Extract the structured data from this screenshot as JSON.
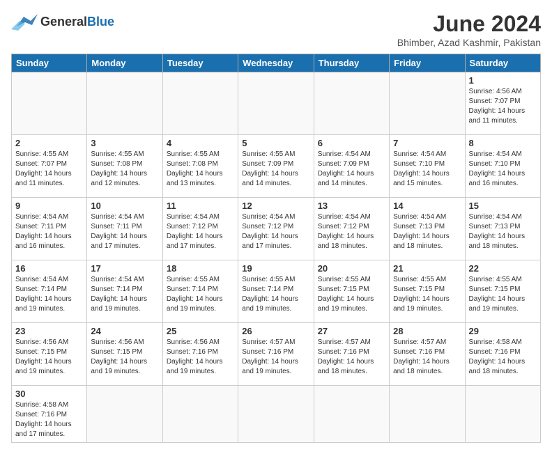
{
  "header": {
    "logo_general": "General",
    "logo_blue": "Blue",
    "month_title": "June 2024",
    "location": "Bhimber, Azad Kashmir, Pakistan"
  },
  "days_of_week": [
    "Sunday",
    "Monday",
    "Tuesday",
    "Wednesday",
    "Thursday",
    "Friday",
    "Saturday"
  ],
  "weeks": [
    [
      {
        "day": "",
        "info": ""
      },
      {
        "day": "",
        "info": ""
      },
      {
        "day": "",
        "info": ""
      },
      {
        "day": "",
        "info": ""
      },
      {
        "day": "",
        "info": ""
      },
      {
        "day": "",
        "info": ""
      },
      {
        "day": "1",
        "info": "Sunrise: 4:56 AM\nSunset: 7:07 PM\nDaylight: 14 hours\nand 11 minutes."
      }
    ],
    [
      {
        "day": "2",
        "info": "Sunrise: 4:55 AM\nSunset: 7:07 PM\nDaylight: 14 hours\nand 11 minutes."
      },
      {
        "day": "3",
        "info": "Sunrise: 4:55 AM\nSunset: 7:08 PM\nDaylight: 14 hours\nand 12 minutes."
      },
      {
        "day": "4",
        "info": "Sunrise: 4:55 AM\nSunset: 7:08 PM\nDaylight: 14 hours\nand 13 minutes."
      },
      {
        "day": "5",
        "info": "Sunrise: 4:55 AM\nSunset: 7:09 PM\nDaylight: 14 hours\nand 14 minutes."
      },
      {
        "day": "6",
        "info": "Sunrise: 4:54 AM\nSunset: 7:09 PM\nDaylight: 14 hours\nand 14 minutes."
      },
      {
        "day": "7",
        "info": "Sunrise: 4:54 AM\nSunset: 7:10 PM\nDaylight: 14 hours\nand 15 minutes."
      },
      {
        "day": "8",
        "info": "Sunrise: 4:54 AM\nSunset: 7:10 PM\nDaylight: 14 hours\nand 16 minutes."
      }
    ],
    [
      {
        "day": "9",
        "info": "Sunrise: 4:54 AM\nSunset: 7:11 PM\nDaylight: 14 hours\nand 16 minutes."
      },
      {
        "day": "10",
        "info": "Sunrise: 4:54 AM\nSunset: 7:11 PM\nDaylight: 14 hours\nand 17 minutes."
      },
      {
        "day": "11",
        "info": "Sunrise: 4:54 AM\nSunset: 7:12 PM\nDaylight: 14 hours\nand 17 minutes."
      },
      {
        "day": "12",
        "info": "Sunrise: 4:54 AM\nSunset: 7:12 PM\nDaylight: 14 hours\nand 17 minutes."
      },
      {
        "day": "13",
        "info": "Sunrise: 4:54 AM\nSunset: 7:12 PM\nDaylight: 14 hours\nand 18 minutes."
      },
      {
        "day": "14",
        "info": "Sunrise: 4:54 AM\nSunset: 7:13 PM\nDaylight: 14 hours\nand 18 minutes."
      },
      {
        "day": "15",
        "info": "Sunrise: 4:54 AM\nSunset: 7:13 PM\nDaylight: 14 hours\nand 18 minutes."
      }
    ],
    [
      {
        "day": "16",
        "info": "Sunrise: 4:54 AM\nSunset: 7:14 PM\nDaylight: 14 hours\nand 19 minutes."
      },
      {
        "day": "17",
        "info": "Sunrise: 4:54 AM\nSunset: 7:14 PM\nDaylight: 14 hours\nand 19 minutes."
      },
      {
        "day": "18",
        "info": "Sunrise: 4:55 AM\nSunset: 7:14 PM\nDaylight: 14 hours\nand 19 minutes."
      },
      {
        "day": "19",
        "info": "Sunrise: 4:55 AM\nSunset: 7:14 PM\nDaylight: 14 hours\nand 19 minutes."
      },
      {
        "day": "20",
        "info": "Sunrise: 4:55 AM\nSunset: 7:15 PM\nDaylight: 14 hours\nand 19 minutes."
      },
      {
        "day": "21",
        "info": "Sunrise: 4:55 AM\nSunset: 7:15 PM\nDaylight: 14 hours\nand 19 minutes."
      },
      {
        "day": "22",
        "info": "Sunrise: 4:55 AM\nSunset: 7:15 PM\nDaylight: 14 hours\nand 19 minutes."
      }
    ],
    [
      {
        "day": "23",
        "info": "Sunrise: 4:56 AM\nSunset: 7:15 PM\nDaylight: 14 hours\nand 19 minutes."
      },
      {
        "day": "24",
        "info": "Sunrise: 4:56 AM\nSunset: 7:15 PM\nDaylight: 14 hours\nand 19 minutes."
      },
      {
        "day": "25",
        "info": "Sunrise: 4:56 AM\nSunset: 7:16 PM\nDaylight: 14 hours\nand 19 minutes."
      },
      {
        "day": "26",
        "info": "Sunrise: 4:57 AM\nSunset: 7:16 PM\nDaylight: 14 hours\nand 19 minutes."
      },
      {
        "day": "27",
        "info": "Sunrise: 4:57 AM\nSunset: 7:16 PM\nDaylight: 14 hours\nand 18 minutes."
      },
      {
        "day": "28",
        "info": "Sunrise: 4:57 AM\nSunset: 7:16 PM\nDaylight: 14 hours\nand 18 minutes."
      },
      {
        "day": "29",
        "info": "Sunrise: 4:58 AM\nSunset: 7:16 PM\nDaylight: 14 hours\nand 18 minutes."
      }
    ],
    [
      {
        "day": "30",
        "info": "Sunrise: 4:58 AM\nSunset: 7:16 PM\nDaylight: 14 hours\nand 17 minutes."
      },
      {
        "day": "",
        "info": ""
      },
      {
        "day": "",
        "info": ""
      },
      {
        "day": "",
        "info": ""
      },
      {
        "day": "",
        "info": ""
      },
      {
        "day": "",
        "info": ""
      },
      {
        "day": "",
        "info": ""
      }
    ]
  ]
}
